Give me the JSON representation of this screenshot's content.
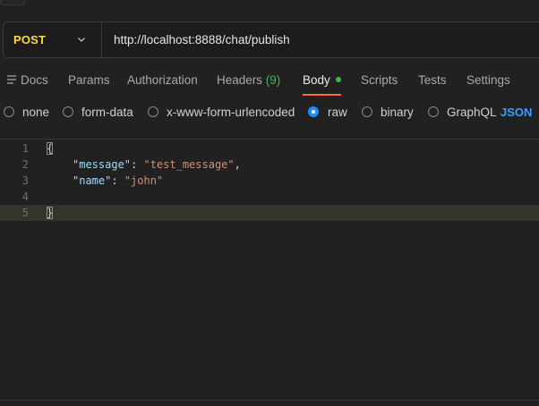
{
  "request": {
    "method": "POST",
    "url": "http://localhost:8888/chat/publish"
  },
  "tabs": [
    {
      "label": "Docs"
    },
    {
      "label": "Params"
    },
    {
      "label": "Authorization"
    },
    {
      "label": "Headers",
      "count": "(9)"
    },
    {
      "label": "Body"
    },
    {
      "label": "Scripts"
    },
    {
      "label": "Tests"
    },
    {
      "label": "Settings"
    }
  ],
  "body_types": {
    "options": [
      "none",
      "form-data",
      "x-www-form-urlencoded",
      "raw",
      "binary",
      "GraphQL"
    ],
    "selected": "raw",
    "format": "JSON"
  },
  "editor": {
    "line_numbers": [
      "1",
      "2",
      "3",
      "4",
      "5"
    ],
    "open_brace": "{",
    "close_brace": "}",
    "fields": [
      {
        "key": "\"message\"",
        "value": "\"test_message\""
      },
      {
        "key": "\"name\"",
        "value": "\"john\""
      }
    ]
  },
  "colors": {
    "method": "#ffd54a",
    "accent": "#ff6c37",
    "active_dot": "#3fb950",
    "radio_selected": "#1f8fff",
    "json": "#3b9eff"
  }
}
